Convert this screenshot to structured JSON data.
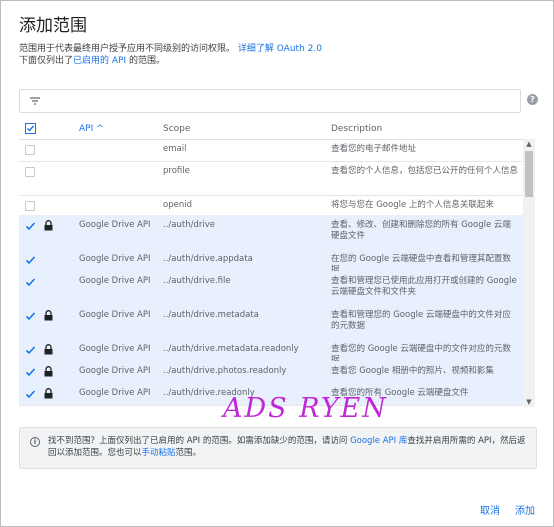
{
  "title": "添加范围",
  "description": {
    "line1_prefix": "范围用于代表最终用户授予应用不同级别的访问权限。",
    "learn_more_link": "详细了解 OAuth 2.0",
    "line2_prefix": "下面仅列出了",
    "enabled_api_link": "已启用的 API",
    "line2_suffix": " 的范围。"
  },
  "filter": {
    "icon": "filter-icon",
    "help_icon": "help-icon",
    "help_glyph": "?"
  },
  "table": {
    "headers": {
      "api": "API ^",
      "scope": "Scope",
      "description": "Description"
    },
    "rows": [
      {
        "checked": false,
        "locked": false,
        "api": "",
        "scope": "email",
        "description": "查看您的电子邮件地址"
      },
      {
        "checked": false,
        "locked": false,
        "api": "",
        "scope": "profile",
        "description": "查看您的个人信息，包括您已公开的任何个人信息"
      },
      {
        "checked": false,
        "locked": false,
        "api": "",
        "scope": "openid",
        "description": "将您与您在 Google 上的个人信息关联起来"
      },
      {
        "checked": true,
        "locked": true,
        "api": "Google Drive API",
        "scope": "../auth/drive",
        "description": "查看、修改、创建和删除您的所有 Google 云端硬盘文件"
      },
      {
        "checked": true,
        "locked": false,
        "api": "Google Drive API",
        "scope": "../auth/drive.appdata",
        "description": "在您的 Google 云端硬盘中查看和管理其配置数据"
      },
      {
        "checked": true,
        "locked": false,
        "api": "Google Drive API",
        "scope": "../auth/drive.file",
        "description": "查看和管理您已使用此应用打开或创建的 Google 云端硬盘文件和文件夹"
      },
      {
        "checked": true,
        "locked": true,
        "api": "Google Drive API",
        "scope": "../auth/drive.metadata",
        "description": "查看和管理您的 Google 云端硬盘中的文件对应的元数据"
      },
      {
        "checked": true,
        "locked": true,
        "api": "Google Drive API",
        "scope": "../auth/drive.metadata.readonly",
        "description": "查看您的 Google 云端硬盘中的文件对应的元数据"
      },
      {
        "checked": true,
        "locked": true,
        "api": "Google Drive API",
        "scope": "../auth/drive.photos.readonly",
        "description": "查看您 Google 相册中的照片、视频和影集"
      },
      {
        "checked": true,
        "locked": true,
        "api": "Google Drive API",
        "scope": "../auth/drive.readonly",
        "description": "查看您的所有 Google 云端硬盘文件"
      }
    ]
  },
  "notice": {
    "icon": "info-icon",
    "icon_glyph": "i",
    "text_prefix": "找不到范围？上面仅列出了已启用的 API 的范围。如需添加缺少的范围，请访问 ",
    "library_link": "Google API 库",
    "text_mid": "查找并启用所需的 API，然后返回以添加范围。您也可以",
    "manual_link": "手动粘贴",
    "text_suffix": "范围。"
  },
  "buttons": {
    "cancel": "取消",
    "add": "添加"
  },
  "watermark": "ADS RYEN",
  "colors": {
    "accent": "#1a73e8",
    "selected_row": "#e8f0fe",
    "watermark": "#c028d6"
  }
}
